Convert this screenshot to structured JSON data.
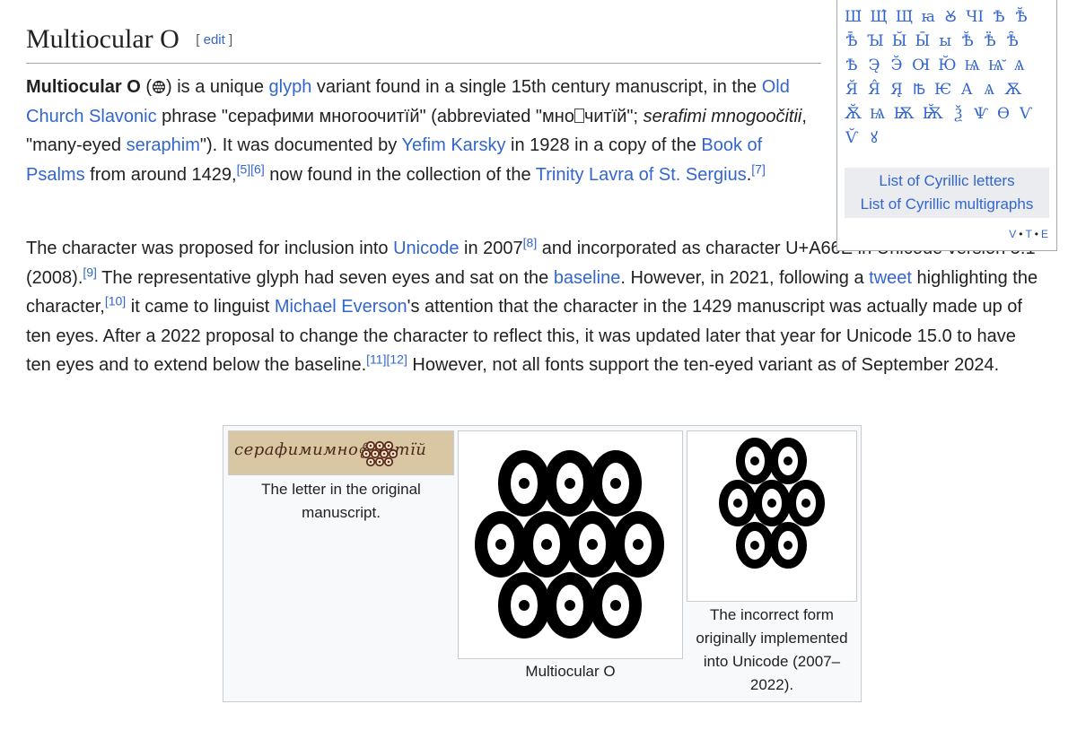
{
  "section": {
    "title": "Multiocular O",
    "edit_open": "[",
    "edit_label": "edit",
    "edit_close": "]"
  },
  "para1": {
    "bold": "Multiocular O",
    "t1": " (",
    "t2": ") is a unique ",
    "link_glyph": "glyph",
    "t3": " variant found in a single 15th century manuscript, in the ",
    "link_ocs": "Old Church Slavonic",
    "t4": " phrase \"серафими многоочитїй\" (abbreviated \"мно",
    "t4b": "читїй\"; ",
    "italic": "serafimi mnogoočitii",
    "t5": ", \"many-eyed ",
    "link_seraphim": "seraphim",
    "t6": "\"). It was documented by ",
    "link_karsky": "Yefim Karsky",
    "t7": " in 1928 in a copy of the ",
    "link_psalms": "Book of Psalms",
    "t8": " from around 1429,",
    "ref5": "[5]",
    "ref6": "[6]",
    "t9": " now found in the collection of the ",
    "link_trinity": "Trinity Lavra of St. Sergius",
    "t10": ".",
    "ref7": "[7]"
  },
  "para2": {
    "t1": "The character was proposed for inclusion into ",
    "link_unicode": "Unicode",
    "t2": " in 2007",
    "ref8": "[8]",
    "t3": " and incorporated as character U+A66E in Unicode version 5.1 (2008).",
    "ref9": "[9]",
    "t4": " The representative glyph had seven eyes and sat on the ",
    "link_baseline": "baseline",
    "t5": ". However, in 2021, following a ",
    "link_tweet": "tweet",
    "t6": " highlighting the character,",
    "ref10": "[10]",
    "t7": " it came to linguist ",
    "link_everson": "Michael Everson",
    "t8": "'s attention that the character in the 1429 manuscript was actually made up of ten eyes. After a 2022 proposal to change the character to reflect this, it was updated later that year for Unicode 15.0 to have ten eyes and to extend below the baseline.",
    "ref11": "[11]",
    "ref12": "[12]",
    "t9": " However, not all fonts support the ten-eyed variant as of September 2024."
  },
  "navbox": {
    "rows": [
      [
        "Ш̆",
        "Щ̂",
        "Щ̆",
        "ꙗ",
        "Ꙋ",
        "ЧІ",
        "Ѣ",
        "Ѣ̆"
      ],
      [
        "Ѣ̄",
        "Ꙑ",
        "Ы̆",
        "Ы̄",
        "ы",
        "Ѣ̆",
        "Ѣ̈",
        "Ѣ̑"
      ],
      [
        "Ѣ",
        "Э̨",
        "Э̆",
        "Ꙕ",
        "Ю̆",
        "Ѩ",
        "Ѩ̆",
        "Ѧ"
      ],
      [
        "Я̆",
        "Я̂",
        "Я̨",
        "Ꙓ",
        "Ѥ",
        "А",
        "Ѧ",
        "Ѫ"
      ],
      [
        "Ѫ̆",
        "Ѩ",
        "Ѭ",
        "Ѭ̆",
        "Ѯ",
        "Ѱ",
        "Ѳ",
        "Ѵ"
      ],
      [
        "Ѵ̆",
        "ꙋ"
      ]
    ],
    "list_letters": "List of Cyrillic letters",
    "list_multigraphs": "List of Cyrillic multigraphs",
    "v": "V",
    "dot": "•",
    "t": "T",
    "e": "E"
  },
  "gallery": {
    "manuscript_text": "серафимимноꙮчитїй",
    "caption1": "The letter in the original manuscript.",
    "caption2": "Multiocular O",
    "caption3": "The incorrect form originally implemented into Unicode (2007–2022)."
  },
  "colors": {
    "link": "#3366cc",
    "text": "#202122",
    "border": "#a2a9b1",
    "navbox_bg": "#eaecf0"
  }
}
